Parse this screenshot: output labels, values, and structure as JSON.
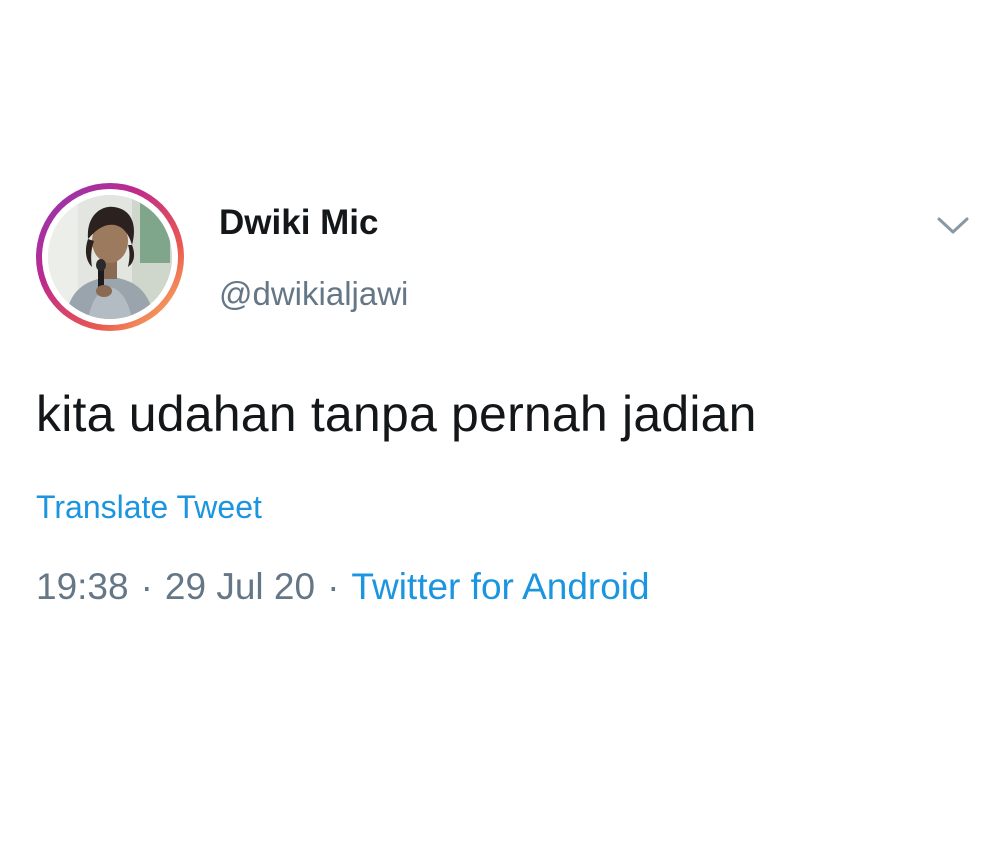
{
  "tweet": {
    "author": {
      "display_name": "Dwiki Mic",
      "handle": "@dwikialjawi",
      "avatar_icon": "user-photo-avatar",
      "ring_colors": [
        "#8a3ab9",
        "#bc2a8d",
        "#e95950",
        "#fccc63"
      ]
    },
    "menu_icon": "chevron-down-icon",
    "text": "kita udahan tanpa pernah jadian",
    "translate_label": "Translate Tweet",
    "time": "19:38",
    "date": "29 Jul 20",
    "separator": "·",
    "source": "Twitter for Android"
  },
  "colors": {
    "link": "#1b95e0",
    "secondary_text": "#657786",
    "primary_text": "#14171a"
  }
}
